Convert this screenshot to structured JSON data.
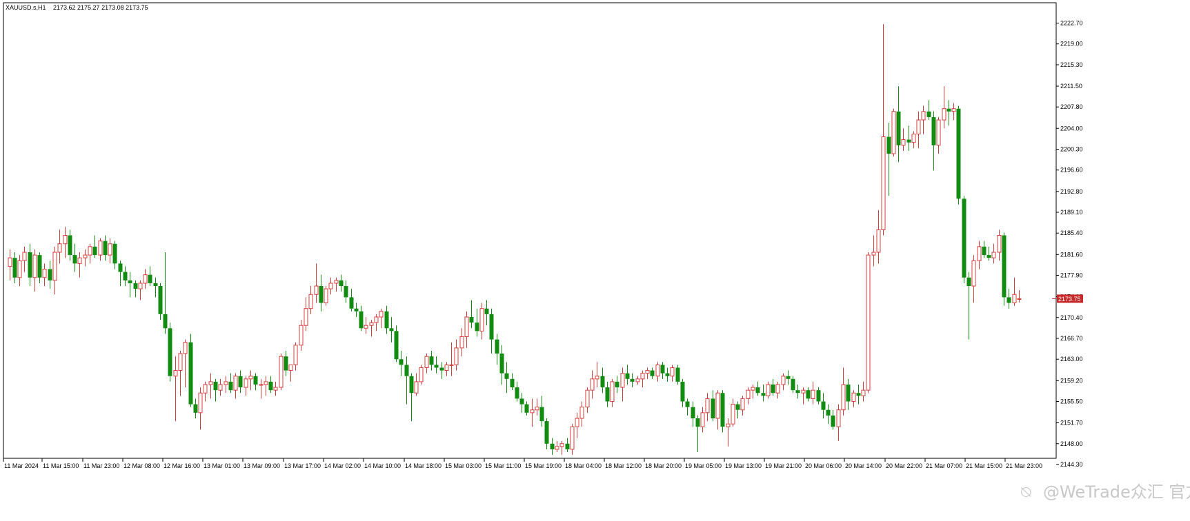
{
  "header": {
    "symbol": "XAUUSD.s,H1",
    "ohlc": "2173.62 2175.27 2173.08 2173.75"
  },
  "watermark": "@WeTrade众汇 官方",
  "colors": {
    "bull": "#d43c3c",
    "bear": "#118c11",
    "price_badge": "#c82828",
    "axis": "#000000"
  },
  "chart_data": {
    "type": "candlestick",
    "symbol": "XAUUSD.s",
    "timeframe": "H1",
    "ylim": [
      2144.3,
      2225.0
    ],
    "y_ticks": [
      "2222.70",
      "2219.00",
      "2215.30",
      "2211.50",
      "2207.80",
      "2204.00",
      "2200.30",
      "2196.60",
      "2192.80",
      "2189.10",
      "2185.40",
      "2181.60",
      "2177.90",
      "2174.10",
      "2170.40",
      "2166.70",
      "2163.00",
      "2159.20",
      "2155.50",
      "2151.70",
      "2148.00",
      "2144.30"
    ],
    "x_ticks": [
      "11 Mar 2024",
      "11 Mar 15:00",
      "11 Mar 23:00",
      "12 Mar 08:00",
      "12 Mar 16:00",
      "13 Mar 01:00",
      "13 Mar 09:00",
      "13 Mar 17:00",
      "14 Mar 02:00",
      "14 Mar 10:00",
      "14 Mar 18:00",
      "15 Mar 03:00",
      "15 Mar 11:00",
      "15 Mar 19:00",
      "18 Mar 04:00",
      "18 Mar 12:00",
      "18 Mar 20:00",
      "19 Mar 05:00",
      "19 Mar 13:00",
      "19 Mar 21:00",
      "20 Mar 06:00",
      "20 Mar 14:00",
      "20 Mar 22:00",
      "21 Mar 07:00",
      "21 Mar 15:00",
      "21 Mar 23:00"
    ],
    "current_price": "2173.75",
    "candles": [
      [
        2179.5,
        2182.5,
        2177.0,
        2181.0
      ],
      [
        2181.0,
        2182.0,
        2176.5,
        2177.5
      ],
      [
        2177.5,
        2181.5,
        2176.0,
        2180.5
      ],
      [
        2180.5,
        2183.0,
        2178.5,
        2182.0
      ],
      [
        2182.0,
        2183.5,
        2176.0,
        2177.5
      ],
      [
        2177.5,
        2182.5,
        2175.0,
        2181.5
      ],
      [
        2181.5,
        2182.0,
        2176.5,
        2177.5
      ],
      [
        2177.5,
        2180.0,
        2176.0,
        2179.0
      ],
      [
        2179.0,
        2180.5,
        2175.5,
        2177.0
      ],
      [
        2177.0,
        2183.0,
        2174.5,
        2182.0
      ],
      [
        2182.0,
        2186.0,
        2180.0,
        2183.5
      ],
      [
        2183.5,
        2186.5,
        2181.0,
        2185.0
      ],
      [
        2185.0,
        2186.0,
        2180.5,
        2181.5
      ],
      [
        2181.5,
        2183.5,
        2178.5,
        2180.0
      ],
      [
        2180.0,
        2182.0,
        2177.5,
        2181.0
      ],
      [
        2181.0,
        2182.5,
        2179.5,
        2181.5
      ],
      [
        2181.5,
        2183.5,
        2180.0,
        2183.0
      ],
      [
        2183.0,
        2185.0,
        2181.0,
        2181.5
      ],
      [
        2181.5,
        2184.5,
        2180.5,
        2184.0
      ],
      [
        2184.0,
        2185.0,
        2180.5,
        2181.5
      ],
      [
        2181.5,
        2184.5,
        2180.0,
        2183.5
      ],
      [
        2183.5,
        2184.0,
        2179.0,
        2180.0
      ],
      [
        2180.0,
        2180.5,
        2176.0,
        2178.5
      ],
      [
        2178.5,
        2179.5,
        2176.0,
        2177.0
      ],
      [
        2177.0,
        2178.5,
        2174.0,
        2176.5
      ],
      [
        2176.5,
        2177.0,
        2174.0,
        2175.5
      ],
      [
        2175.5,
        2177.0,
        2173.5,
        2176.5
      ],
      [
        2176.5,
        2179.0,
        2175.5,
        2178.0
      ],
      [
        2178.0,
        2179.5,
        2176.0,
        2176.5
      ],
      [
        2176.5,
        2177.5,
        2174.0,
        2176.0
      ],
      [
        2176.0,
        2176.5,
        2170.0,
        2171.0
      ],
      [
        2171.0,
        2182.0,
        2167.5,
        2168.5
      ],
      [
        2168.5,
        2169.5,
        2159.0,
        2160.0
      ],
      [
        2160.0,
        2163.5,
        2152.0,
        2161.0
      ],
      [
        2161.0,
        2164.5,
        2156.5,
        2164.0
      ],
      [
        2164.0,
        2166.5,
        2158.0,
        2166.0
      ],
      [
        2166.0,
        2167.5,
        2154.5,
        2155.0
      ],
      [
        2155.0,
        2156.0,
        2152.5,
        2153.5
      ],
      [
        2153.5,
        2158.0,
        2150.5,
        2157.0
      ],
      [
        2157.0,
        2159.0,
        2155.5,
        2158.5
      ],
      [
        2158.5,
        2160.5,
        2156.0,
        2159.0
      ],
      [
        2159.0,
        2159.5,
        2155.5,
        2157.5
      ],
      [
        2157.5,
        2159.5,
        2156.5,
        2158.5
      ],
      [
        2158.5,
        2160.0,
        2157.0,
        2159.0
      ],
      [
        2159.0,
        2160.5,
        2157.0,
        2157.5
      ],
      [
        2157.5,
        2160.5,
        2156.0,
        2160.0
      ],
      [
        2160.0,
        2161.0,
        2157.0,
        2158.0
      ],
      [
        2158.0,
        2160.0,
        2156.5,
        2159.5
      ],
      [
        2159.5,
        2161.0,
        2157.5,
        2160.0
      ],
      [
        2160.0,
        2160.5,
        2157.5,
        2158.5
      ],
      [
        2158.5,
        2159.5,
        2156.0,
        2158.5
      ],
      [
        2158.5,
        2160.0,
        2156.5,
        2159.0
      ],
      [
        2159.0,
        2160.0,
        2157.0,
        2157.5
      ],
      [
        2157.5,
        2159.0,
        2156.5,
        2158.0
      ],
      [
        2158.0,
        2164.0,
        2157.5,
        2163.5
      ],
      [
        2163.5,
        2164.5,
        2160.0,
        2161.0
      ],
      [
        2161.0,
        2162.0,
        2159.0,
        2162.0
      ],
      [
        2162.0,
        2166.0,
        2161.0,
        2165.5
      ],
      [
        2165.5,
        2170.0,
        2164.5,
        2169.0
      ],
      [
        2169.0,
        2174.0,
        2168.0,
        2172.0
      ],
      [
        2172.0,
        2176.0,
        2171.0,
        2174.5
      ],
      [
        2174.5,
        2180.0,
        2173.0,
        2176.0
      ],
      [
        2176.0,
        2178.0,
        2171.5,
        2173.0
      ],
      [
        2173.0,
        2176.0,
        2172.5,
        2175.5
      ],
      [
        2175.5,
        2177.5,
        2174.5,
        2176.5
      ],
      [
        2176.5,
        2177.5,
        2175.0,
        2177.0
      ],
      [
        2177.0,
        2178.0,
        2175.0,
        2176.0
      ],
      [
        2176.0,
        2177.0,
        2173.0,
        2174.0
      ],
      [
        2174.0,
        2175.5,
        2171.5,
        2172.0
      ],
      [
        2172.0,
        2173.0,
        2170.5,
        2171.5
      ],
      [
        2171.5,
        2172.5,
        2168.0,
        2168.5
      ],
      [
        2168.5,
        2170.5,
        2167.5,
        2169.0
      ],
      [
        2169.0,
        2170.0,
        2167.0,
        2169.5
      ],
      [
        2169.5,
        2171.0,
        2168.0,
        2170.5
      ],
      [
        2170.5,
        2172.0,
        2168.5,
        2171.5
      ],
      [
        2171.5,
        2172.5,
        2167.5,
        2168.5
      ],
      [
        2168.5,
        2170.5,
        2166.0,
        2168.0
      ],
      [
        2168.0,
        2169.0,
        2162.5,
        2163.0
      ],
      [
        2163.0,
        2164.5,
        2160.0,
        2162.0
      ],
      [
        2162.0,
        2163.5,
        2155.0,
        2160.0
      ],
      [
        2160.0,
        2160.5,
        2152.0,
        2157.0
      ],
      [
        2157.0,
        2160.5,
        2156.5,
        2159.0
      ],
      [
        2159.0,
        2162.0,
        2158.5,
        2161.5
      ],
      [
        2161.5,
        2164.0,
        2160.5,
        2163.5
      ],
      [
        2163.5,
        2164.5,
        2161.0,
        2162.0
      ],
      [
        2162.0,
        2163.5,
        2160.5,
        2161.5
      ],
      [
        2161.5,
        2162.5,
        2159.5,
        2161.0
      ],
      [
        2161.0,
        2162.5,
        2160.0,
        2162.0
      ],
      [
        2162.0,
        2166.0,
        2160.0,
        2162.0
      ],
      [
        2162.0,
        2166.5,
        2161.0,
        2165.0
      ],
      [
        2165.0,
        2168.5,
        2163.5,
        2167.0
      ],
      [
        2167.0,
        2171.5,
        2165.0,
        2170.5
      ],
      [
        2170.5,
        2173.5,
        2168.5,
        2169.5
      ],
      [
        2169.5,
        2172.0,
        2167.0,
        2168.0
      ],
      [
        2168.0,
        2173.0,
        2166.5,
        2172.0
      ],
      [
        2172.0,
        2173.5,
        2169.0,
        2171.0
      ],
      [
        2171.0,
        2172.0,
        2164.0,
        2166.5
      ],
      [
        2166.5,
        2167.5,
        2162.0,
        2164.0
      ],
      [
        2164.0,
        2165.5,
        2158.5,
        2160.5
      ],
      [
        2160.5,
        2162.5,
        2157.0,
        2159.5
      ],
      [
        2159.5,
        2160.5,
        2157.5,
        2158.0
      ],
      [
        2158.0,
        2159.0,
        2155.5,
        2156.0
      ],
      [
        2156.0,
        2157.0,
        2153.5,
        2155.0
      ],
      [
        2155.0,
        2155.5,
        2153.0,
        2153.5
      ],
      [
        2153.5,
        2156.0,
        2151.0,
        2154.0
      ],
      [
        2154.0,
        2156.0,
        2153.0,
        2154.5
      ],
      [
        2154.5,
        2156.5,
        2151.0,
        2152.0
      ],
      [
        2152.0,
        2152.5,
        2147.0,
        2148.0
      ],
      [
        2148.0,
        2149.0,
        2146.0,
        2147.0
      ],
      [
        2147.0,
        2148.5,
        2146.5,
        2147.5
      ],
      [
        2147.5,
        2148.5,
        2146.0,
        2148.0
      ],
      [
        2148.0,
        2149.0,
        2146.5,
        2147.0
      ],
      [
        2147.0,
        2151.5,
        2146.0,
        2151.0
      ],
      [
        2151.0,
        2153.5,
        2149.0,
        2152.5
      ],
      [
        2152.5,
        2155.5,
        2151.0,
        2154.5
      ],
      [
        2154.5,
        2158.0,
        2153.5,
        2157.5
      ],
      [
        2157.5,
        2161.0,
        2156.0,
        2159.5
      ],
      [
        2159.5,
        2162.5,
        2158.0,
        2160.0
      ],
      [
        2160.0,
        2161.5,
        2157.0,
        2158.0
      ],
      [
        2158.0,
        2159.0,
        2154.5,
        2155.5
      ],
      [
        2155.5,
        2159.5,
        2154.5,
        2159.0
      ],
      [
        2159.0,
        2160.0,
        2157.0,
        2158.0
      ],
      [
        2158.0,
        2161.5,
        2155.5,
        2160.5
      ],
      [
        2160.5,
        2162.0,
        2158.5,
        2159.5
      ],
      [
        2159.5,
        2160.5,
        2158.0,
        2159.0
      ],
      [
        2159.0,
        2160.0,
        2158.5,
        2159.5
      ],
      [
        2159.5,
        2161.0,
        2158.0,
        2160.5
      ],
      [
        2160.5,
        2161.5,
        2159.5,
        2161.0
      ],
      [
        2161.0,
        2161.5,
        2159.5,
        2160.0
      ],
      [
        2160.0,
        2162.5,
        2159.0,
        2162.0
      ],
      [
        2162.0,
        2162.5,
        2159.5,
        2160.5
      ],
      [
        2160.5,
        2161.5,
        2159.0,
        2160.0
      ],
      [
        2160.0,
        2162.0,
        2159.0,
        2161.5
      ],
      [
        2161.5,
        2162.0,
        2158.5,
        2159.0
      ],
      [
        2159.0,
        2159.5,
        2154.5,
        2155.5
      ],
      [
        2155.5,
        2156.0,
        2153.0,
        2154.5
      ],
      [
        2154.5,
        2155.5,
        2151.0,
        2152.5
      ],
      [
        2152.5,
        2153.0,
        2146.5,
        2151.0
      ],
      [
        2151.0,
        2154.5,
        2150.0,
        2153.5
      ],
      [
        2153.5,
        2157.0,
        2152.0,
        2156.0
      ],
      [
        2156.0,
        2157.5,
        2152.0,
        2152.5
      ],
      [
        2152.5,
        2157.5,
        2150.5,
        2157.0
      ],
      [
        2157.0,
        2157.5,
        2150.0,
        2151.0
      ],
      [
        2151.0,
        2152.5,
        2147.5,
        2151.5
      ],
      [
        2151.5,
        2156.0,
        2151.0,
        2155.0
      ],
      [
        2155.0,
        2155.5,
        2152.5,
        2154.0
      ],
      [
        2154.0,
        2156.5,
        2153.0,
        2156.0
      ],
      [
        2156.0,
        2158.0,
        2155.0,
        2157.5
      ],
      [
        2157.5,
        2158.5,
        2156.0,
        2158.0
      ],
      [
        2158.0,
        2159.0,
        2156.5,
        2157.0
      ],
      [
        2157.0,
        2158.5,
        2155.5,
        2156.5
      ],
      [
        2156.5,
        2159.0,
        2156.0,
        2158.5
      ],
      [
        2158.5,
        2159.5,
        2156.5,
        2157.0
      ],
      [
        2157.0,
        2159.0,
        2156.0,
        2158.5
      ],
      [
        2158.5,
        2160.5,
        2157.5,
        2160.0
      ],
      [
        2160.0,
        2161.0,
        2158.5,
        2159.5
      ],
      [
        2159.5,
        2160.0,
        2157.0,
        2157.5
      ],
      [
        2157.5,
        2158.5,
        2156.0,
        2157.0
      ],
      [
        2157.0,
        2158.0,
        2155.0,
        2157.5
      ],
      [
        2157.5,
        2158.0,
        2155.5,
        2156.0
      ],
      [
        2156.0,
        2159.0,
        2155.0,
        2157.5
      ],
      [
        2157.5,
        2158.0,
        2155.0,
        2155.5
      ],
      [
        2155.5,
        2157.0,
        2152.5,
        2154.0
      ],
      [
        2154.0,
        2155.0,
        2151.5,
        2153.0
      ],
      [
        2153.0,
        2154.0,
        2150.5,
        2151.0
      ],
      [
        2151.0,
        2155.0,
        2148.5,
        2154.0
      ],
      [
        2154.0,
        2161.5,
        2153.0,
        2158.5
      ],
      [
        2158.5,
        2159.5,
        2154.0,
        2155.5
      ],
      [
        2155.5,
        2157.5,
        2154.5,
        2157.0
      ],
      [
        2157.0,
        2158.5,
        2155.0,
        2156.5
      ],
      [
        2156.5,
        2159.0,
        2155.5,
        2157.5
      ],
      [
        2157.5,
        2182.0,
        2157.0,
        2181.5
      ],
      [
        2181.5,
        2185.0,
        2179.5,
        2182.0
      ],
      [
        2182.0,
        2189.5,
        2180.0,
        2186.0
      ],
      [
        2186.0,
        2222.5,
        2185.0,
        2202.5
      ],
      [
        2202.5,
        2205.0,
        2192.0,
        2199.5
      ],
      [
        2199.5,
        2207.5,
        2199.0,
        2207.0
      ],
      [
        2207.0,
        2211.5,
        2198.0,
        2201.0
      ],
      [
        2201.0,
        2204.0,
        2200.0,
        2202.0
      ],
      [
        2202.0,
        2204.5,
        2200.0,
        2201.5
      ],
      [
        2201.5,
        2203.5,
        2200.5,
        2203.0
      ],
      [
        2203.0,
        2207.0,
        2200.5,
        2205.5
      ],
      [
        2205.5,
        2208.0,
        2203.0,
        2207.0
      ],
      [
        2207.0,
        2209.0,
        2205.5,
        2206.0
      ],
      [
        2206.0,
        2207.0,
        2196.5,
        2201.0
      ],
      [
        2201.0,
        2206.0,
        2199.5,
        2205.5
      ],
      [
        2205.5,
        2211.5,
        2204.0,
        2207.5
      ],
      [
        2207.5,
        2209.0,
        2204.5,
        2207.0
      ],
      [
        2207.0,
        2208.5,
        2205.5,
        2207.5
      ],
      [
        2207.5,
        2208.0,
        2190.5,
        2191.5
      ],
      [
        2191.5,
        2192.0,
        2176.5,
        2177.5
      ],
      [
        2177.5,
        2178.5,
        2166.5,
        2176.0
      ],
      [
        2176.0,
        2181.5,
        2173.0,
        2180.5
      ],
      [
        2180.5,
        2184.0,
        2179.0,
        2183.0
      ],
      [
        2183.0,
        2184.0,
        2181.0,
        2181.5
      ],
      [
        2181.5,
        2183.0,
        2180.5,
        2181.0
      ],
      [
        2181.0,
        2183.5,
        2180.0,
        2182.0
      ],
      [
        2182.0,
        2186.0,
        2180.5,
        2185.0
      ],
      [
        2185.0,
        2185.5,
        2172.5,
        2174.0
      ],
      [
        2174.0,
        2175.5,
        2172.0,
        2173.0
      ],
      [
        2173.0,
        2177.5,
        2172.5,
        2174.5
      ],
      [
        2173.62,
        2175.27,
        2173.08,
        2173.75
      ]
    ]
  }
}
